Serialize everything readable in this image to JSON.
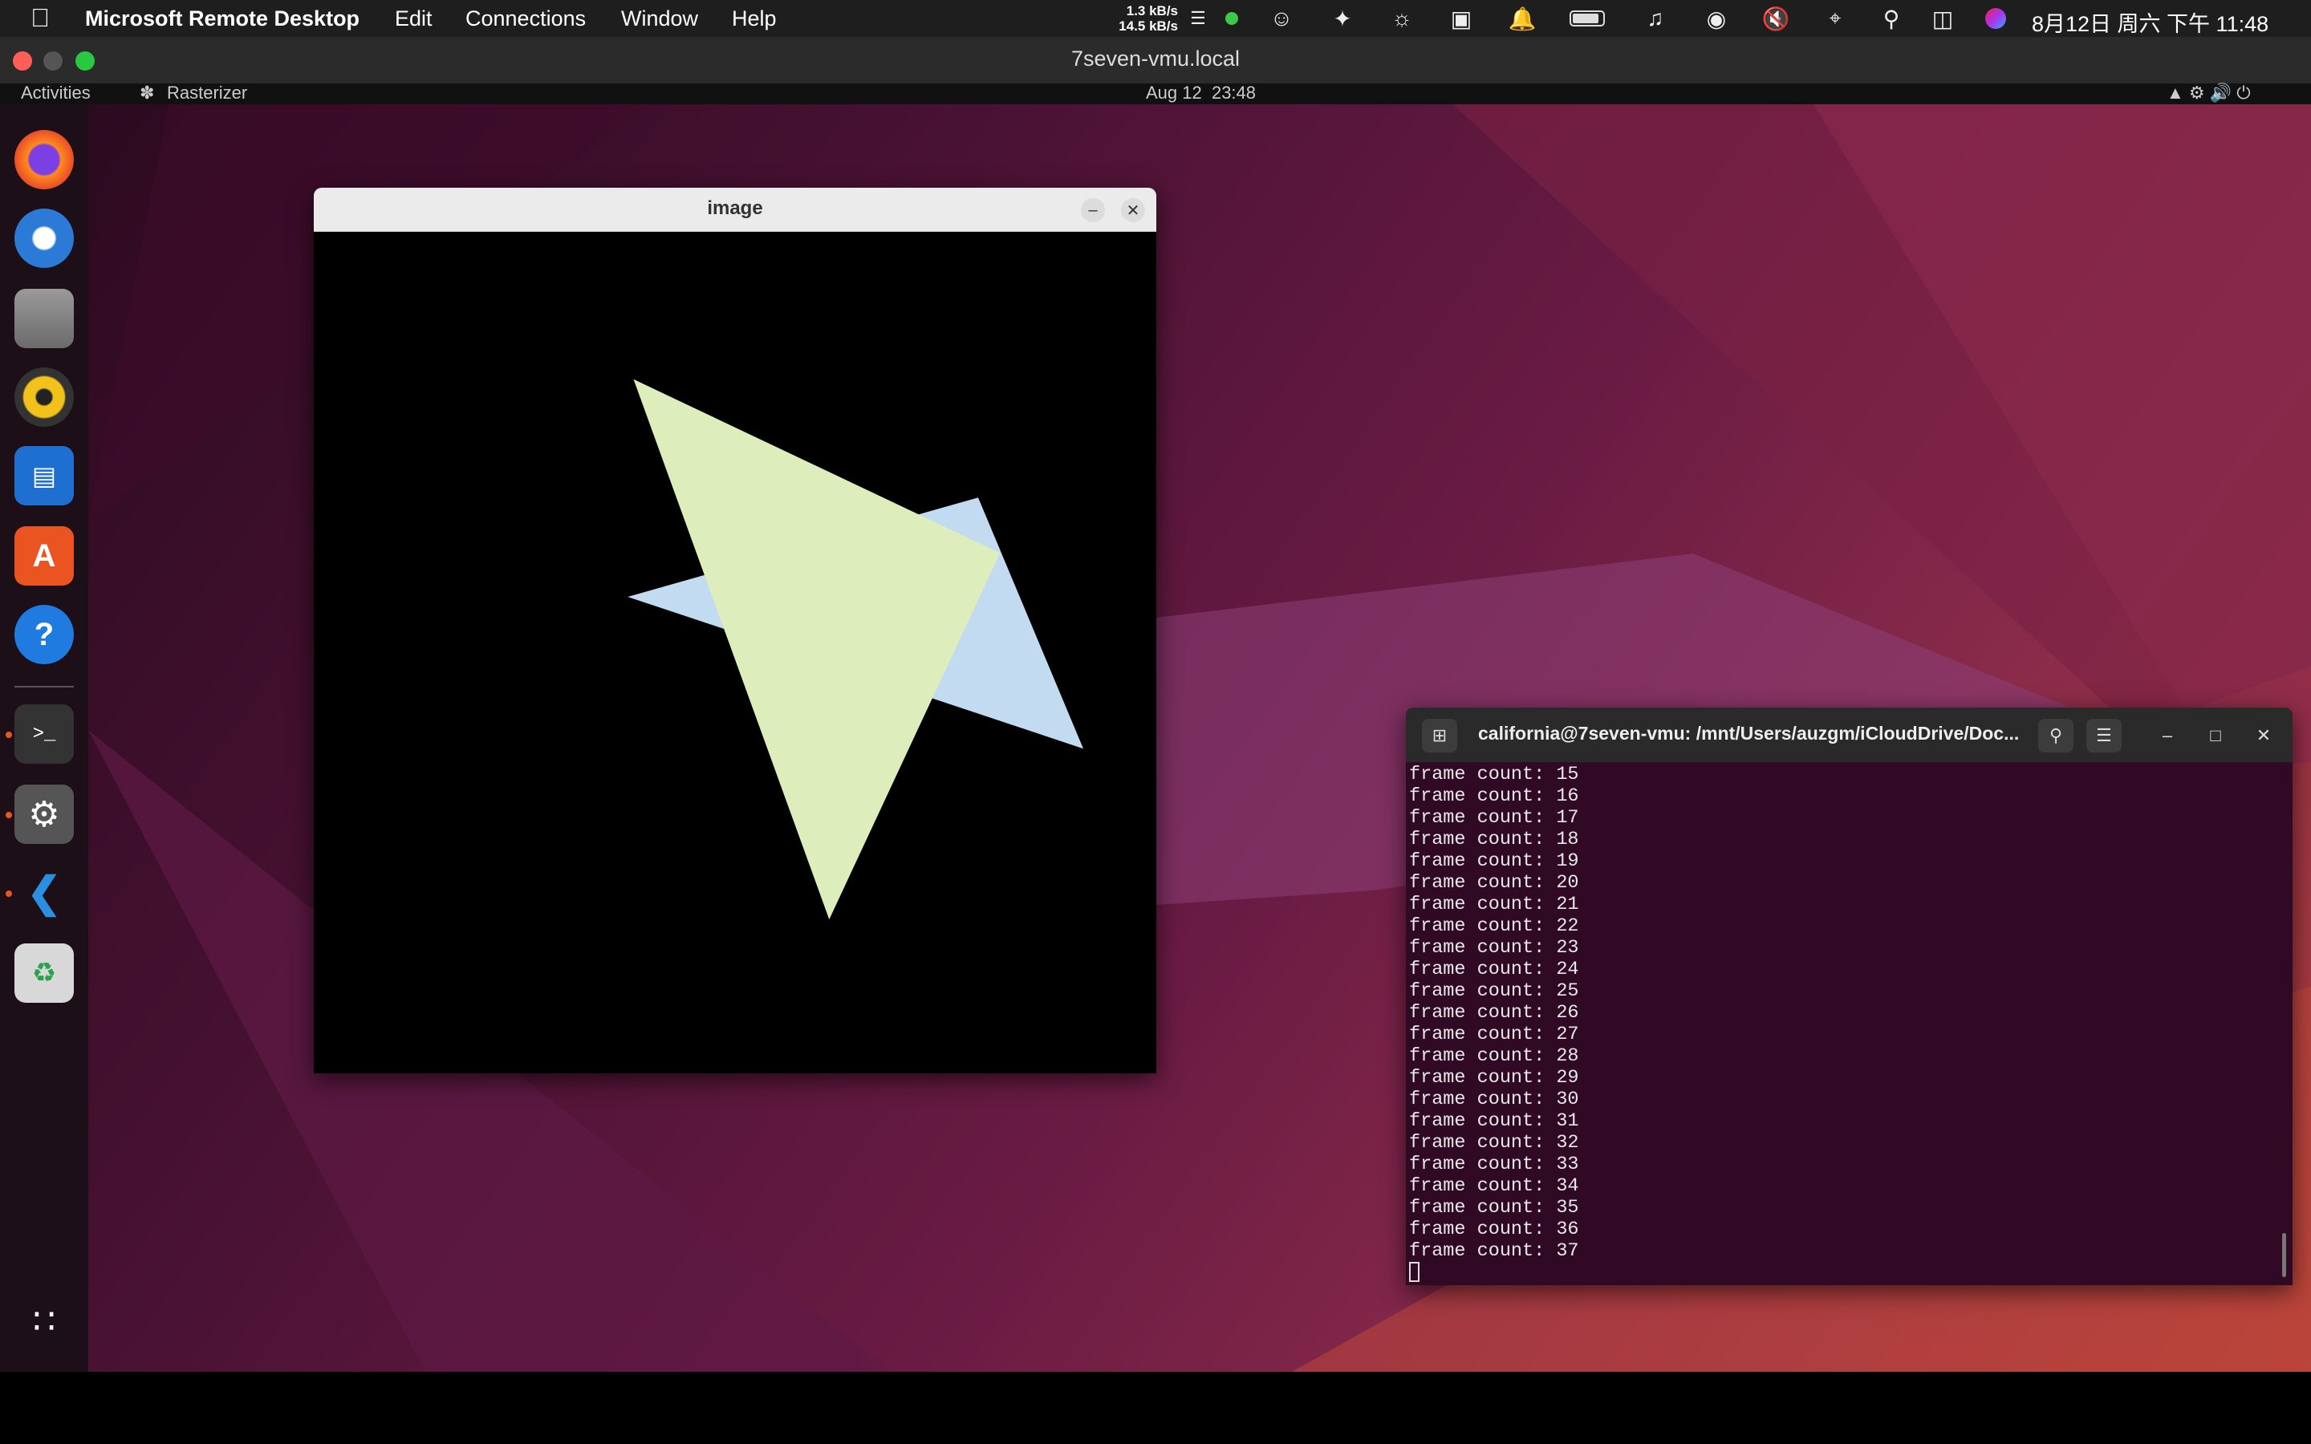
{
  "mac_menubar": {
    "app_name": "Microsoft Remote Desktop",
    "menus": [
      "Edit",
      "Connections",
      "Window",
      "Help"
    ],
    "net_up": "1.3 kB/s",
    "net_down": "14.5 kB/s",
    "datetime": "8月12日 周六 下午 11:48"
  },
  "remote_window": {
    "title": "7seven-vmu.local"
  },
  "ubuntu_topbar": {
    "activities": "Activities",
    "app": "Rasterizer",
    "clock": "Aug 12  23:48"
  },
  "dock": {
    "items": [
      "firefox-icon",
      "thunderbird-icon",
      "files-icon",
      "rhythmbox-icon",
      "writer-icon",
      "app-center-icon",
      "help-icon",
      "terminal-icon",
      "settings-icon",
      "vscode-icon",
      "trash-icon"
    ]
  },
  "image_window": {
    "title": "image",
    "triangles": [
      {
        "color": "#c3dbf0",
        "points": "[[215,250],[455,182],[527,354]]"
      },
      {
        "color": "#ddedbc",
        "points": "[[219,101],[470,220],[353,471]]"
      }
    ]
  },
  "terminal": {
    "title": "california@7seven-vmu: /mnt/Users/auzgm/iCloudDrive/Doc...",
    "lines": [
      "frame count: 15",
      "frame count: 16",
      "frame count: 17",
      "frame count: 18",
      "frame count: 19",
      "frame count: 20",
      "frame count: 21",
      "frame count: 22",
      "frame count: 23",
      "frame count: 24",
      "frame count: 25",
      "frame count: 26",
      "frame count: 27",
      "frame count: 28",
      "frame count: 29",
      "frame count: 30",
      "frame count: 31",
      "frame count: 32",
      "frame count: 33",
      "frame count: 34",
      "frame count: 35",
      "frame count: 36",
      "frame count: 37"
    ]
  }
}
